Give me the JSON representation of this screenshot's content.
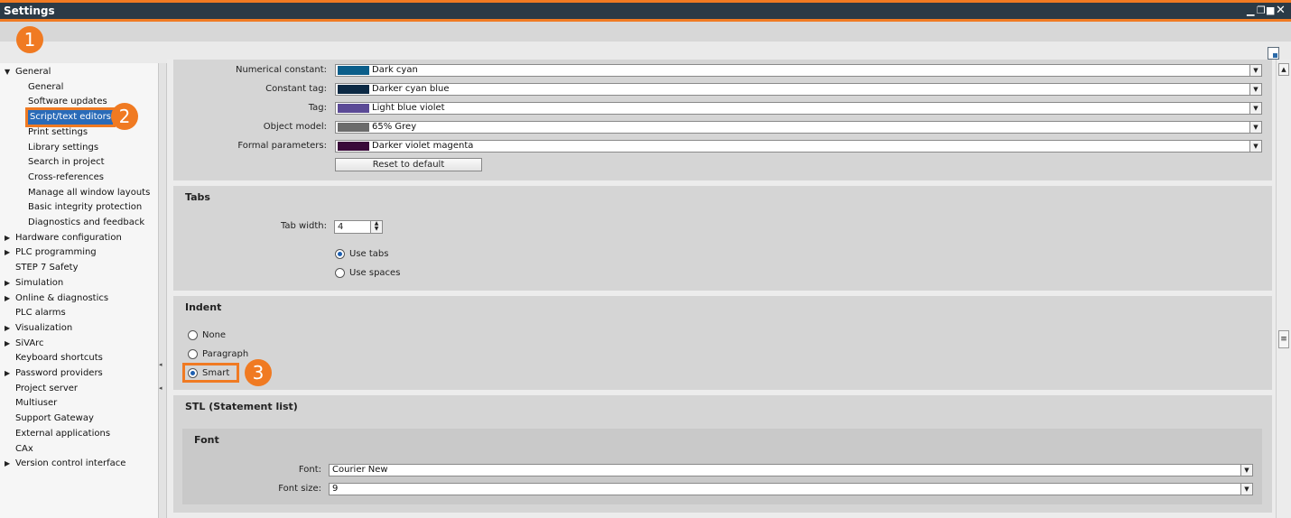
{
  "window": {
    "title": "Settings",
    "controls": [
      "minimize",
      "restore",
      "maximize",
      "close"
    ]
  },
  "annotations": [
    "1",
    "2",
    "3"
  ],
  "accent_color": "#f07a22",
  "selection_color": "#2a6bb8",
  "sidebar": {
    "items": [
      {
        "label": "General",
        "expandable": true,
        "expanded": true
      },
      {
        "label": "General",
        "child": true
      },
      {
        "label": "Software updates",
        "child": true
      },
      {
        "label": "Script/text editors",
        "child": true,
        "selected": true
      },
      {
        "label": "Print settings",
        "child": true
      },
      {
        "label": "Library settings",
        "child": true
      },
      {
        "label": "Search in project",
        "child": true
      },
      {
        "label": "Cross-references",
        "child": true
      },
      {
        "label": "Manage all window layouts",
        "child": true
      },
      {
        "label": "Basic integrity protection",
        "child": true
      },
      {
        "label": "Diagnostics and feedback",
        "child": true
      },
      {
        "label": "Hardware configuration",
        "expandable": true
      },
      {
        "label": "PLC programming",
        "expandable": true
      },
      {
        "label": "STEP 7 Safety"
      },
      {
        "label": "Simulation",
        "expandable": true
      },
      {
        "label": "Online & diagnostics",
        "expandable": true
      },
      {
        "label": "PLC alarms"
      },
      {
        "label": "Visualization",
        "expandable": true
      },
      {
        "label": "SiVArc",
        "expandable": true
      },
      {
        "label": "Keyboard shortcuts"
      },
      {
        "label": "Password providers",
        "expandable": true
      },
      {
        "label": "Project server"
      },
      {
        "label": "Multiuser"
      },
      {
        "label": "Support Gateway"
      },
      {
        "label": "External applications"
      },
      {
        "label": "CAx"
      },
      {
        "label": "Version control interface",
        "expandable": true
      }
    ]
  },
  "colors": {
    "rows": [
      {
        "label": "Numerical constant:",
        "value": "Dark cyan",
        "swatch": "#0b5e8a"
      },
      {
        "label": "Constant tag:",
        "value": "Darker cyan blue",
        "swatch": "#0c2a45"
      },
      {
        "label": "Tag:",
        "value": "Light blue violet",
        "swatch": "#5b4a96"
      },
      {
        "label": "Object model:",
        "value": "65% Grey",
        "swatch": "#6b6b6b"
      },
      {
        "label": "Formal parameters:",
        "value": "Darker violet magenta",
        "swatch": "#3a0a3a"
      }
    ],
    "reset_label": "Reset to default"
  },
  "tabs": {
    "heading": "Tabs",
    "tab_width_label": "Tab width:",
    "tab_width_value": "4",
    "options": [
      {
        "label": "Use tabs",
        "selected": true
      },
      {
        "label": "Use spaces",
        "selected": false
      }
    ]
  },
  "indent": {
    "heading": "Indent",
    "options": [
      {
        "label": "None",
        "selected": false
      },
      {
        "label": "Paragraph",
        "selected": false
      },
      {
        "label": "Smart",
        "selected": true
      }
    ]
  },
  "stl": {
    "heading": "STL (Statement list)",
    "font_heading": "Font",
    "font_label": "Font:",
    "font_value": "Courier New",
    "font_size_label": "Font size:",
    "font_size_value": "9"
  }
}
